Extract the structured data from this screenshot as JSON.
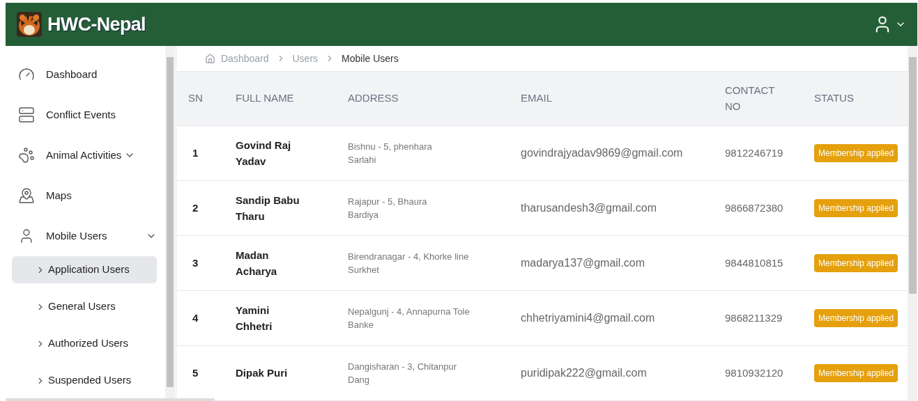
{
  "header": {
    "brand": "HWC-Nepal"
  },
  "sidebar": {
    "items": [
      {
        "kind": "link",
        "label": "Dashboard"
      },
      {
        "kind": "link",
        "label": "Conflict Events"
      },
      {
        "kind": "group",
        "label": "Animal Activities"
      },
      {
        "kind": "link",
        "label": "Maps"
      },
      {
        "kind": "group",
        "label": "Mobile Users",
        "children": [
          {
            "label": "Application Users",
            "selected": true
          },
          {
            "label": "General Users",
            "selected": false
          },
          {
            "label": "Authorized Users",
            "selected": false
          },
          {
            "label": "Suspended Users",
            "selected": false
          }
        ]
      }
    ]
  },
  "breadcrumb": [
    "Dashboard",
    "Users",
    "Mobile Users"
  ],
  "table": {
    "columns": [
      "SN",
      "FULL NAME",
      "ADDRESS",
      "EMAIL",
      "CONTACT NO",
      "STATUS"
    ],
    "rows": [
      {
        "sn": "1",
        "name": "Govind Raj Yadav",
        "address": [
          "Bishnu - 5, phenhara",
          "Sarlahi"
        ],
        "email": "govindrajyadav9869@gmail.com",
        "contact": "9812246719",
        "status": "Membership applied"
      },
      {
        "sn": "2",
        "name": "Sandip Babu Tharu",
        "address": [
          "Rajapur - 5, Bhaura",
          "Bardiya"
        ],
        "email": "tharusandesh3@gmail.com",
        "contact": "9866872380",
        "status": "Membership applied"
      },
      {
        "sn": "3",
        "name": "Madan Acharya",
        "address": [
          "Birendranagar - 4, Khorke line",
          "Surkhet"
        ],
        "email": "madarya137@gmail.com",
        "contact": "9844810815",
        "status": "Membership applied"
      },
      {
        "sn": "4",
        "name": "Yamini Chhetri",
        "address": [
          "Nepalgunj - 4, Annapurna Tole",
          "Banke"
        ],
        "email": "chhetriyamini4@gmail.com",
        "contact": "9868211329",
        "status": "Membership applied"
      },
      {
        "sn": "5",
        "name": "Dipak Puri",
        "address": [
          "Dangisharan - 3, Chitanpur",
          "Dang"
        ],
        "email": "puridipak222@gmail.com",
        "contact": "9810932120",
        "status": "Membership applied"
      }
    ]
  }
}
